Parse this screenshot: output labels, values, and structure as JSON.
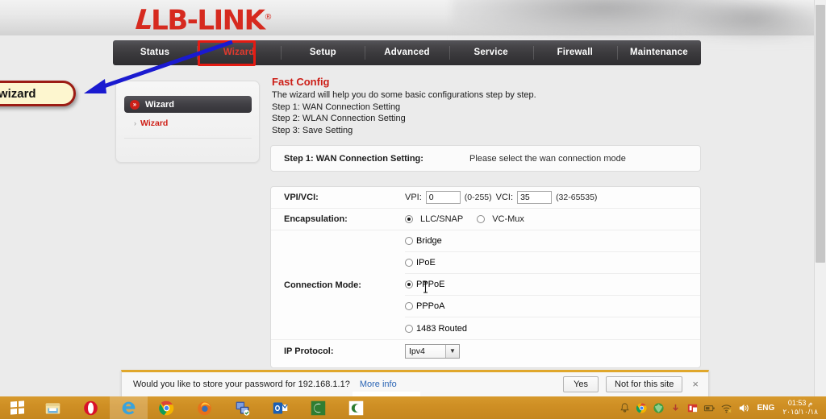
{
  "brand": {
    "logo_text": "LB-LINK",
    "logo_reg": "®",
    "logo_color": "#d62a1f"
  },
  "nav": {
    "items": [
      {
        "label": "Status",
        "active": false
      },
      {
        "label": "Wizard",
        "active": true
      },
      {
        "label": "Setup",
        "active": false
      },
      {
        "label": "Advanced",
        "active": false
      },
      {
        "label": "Service",
        "active": false
      },
      {
        "label": "Firewall",
        "active": false
      },
      {
        "label": "Maintenance",
        "active": false
      }
    ],
    "highlight_color": "#e41b13",
    "active_color": "#e23a2e"
  },
  "sidebar": {
    "header_label": "Wizard",
    "header_bullet": "»",
    "link_label": "Wizard",
    "link_chevron": "›",
    "link_color": "#cf1f17"
  },
  "content": {
    "title": "Fast Config",
    "intro": "The wizard will help you do some basic configurations step by step.",
    "step_lines": [
      "Step 1: WAN Connection Setting",
      "Step 2: WLAN Connection Setting",
      "Step 3: Save Setting"
    ],
    "step_panel": {
      "left": "Step 1: WAN Connection Setting:",
      "right": "Please select the wan connection mode"
    },
    "form": {
      "vpivci": {
        "label": "VPI/VCI:",
        "vpi_label": "VPI:",
        "vpi_value": "0",
        "vpi_hint": "(0-255)",
        "vci_label": "VCI:",
        "vci_value": "35",
        "vci_hint": "(32-65535)"
      },
      "encapsulation": {
        "label": "Encapsulation:",
        "options": [
          {
            "label": "LLC/SNAP",
            "selected": true
          },
          {
            "label": "VC-Mux",
            "selected": false
          }
        ]
      },
      "connection_mode": {
        "label": "Connection Mode:",
        "options": [
          {
            "label": "Bridge",
            "selected": false
          },
          {
            "label": "IPoE",
            "selected": false
          },
          {
            "label": "PPPoE",
            "selected": true
          },
          {
            "label": "PPPoA",
            "selected": false
          },
          {
            "label": "1483 Routed",
            "selected": false
          }
        ]
      },
      "ip_protocol": {
        "label": "IP Protocol:",
        "value": "Ipv4",
        "arrow": "▼"
      }
    }
  },
  "password_bar": {
    "message": "Would you like to store your password for 192.168.1.1?",
    "more_info": "More info",
    "yes_label": "Yes",
    "not_label": "Not for this site",
    "close": "×",
    "accent_color": "#e0a72b"
  },
  "annotation": {
    "callout_text": "k wizard",
    "callout_fill": "#fdf6cf",
    "callout_border": "#9c1c14",
    "arrow_color": "#1a1ad0"
  },
  "taskbar": {
    "start_name": "windows-start",
    "apps": [
      {
        "name": "file-explorer",
        "selected": false
      },
      {
        "name": "opera",
        "selected": false
      },
      {
        "name": "internet-explorer-edge",
        "selected": true
      },
      {
        "name": "google-chrome",
        "selected": false
      },
      {
        "name": "mozilla-firefox",
        "selected": false
      },
      {
        "name": "remote-desktop",
        "selected": false
      },
      {
        "name": "microsoft-outlook",
        "selected": false
      },
      {
        "name": "camtasia-recorder",
        "selected": false
      },
      {
        "name": "camtasia-studio",
        "selected": false
      }
    ],
    "tray": {
      "icons": [
        "notification-bell",
        "chrome-tray",
        "antivirus-shield",
        "update-arrow",
        "kaspersky",
        "battery",
        "network-wifi",
        "volume"
      ],
      "language": "ENG",
      "time": "01:53 م",
      "date": "٢٠١٥/١٠/١٨"
    }
  }
}
